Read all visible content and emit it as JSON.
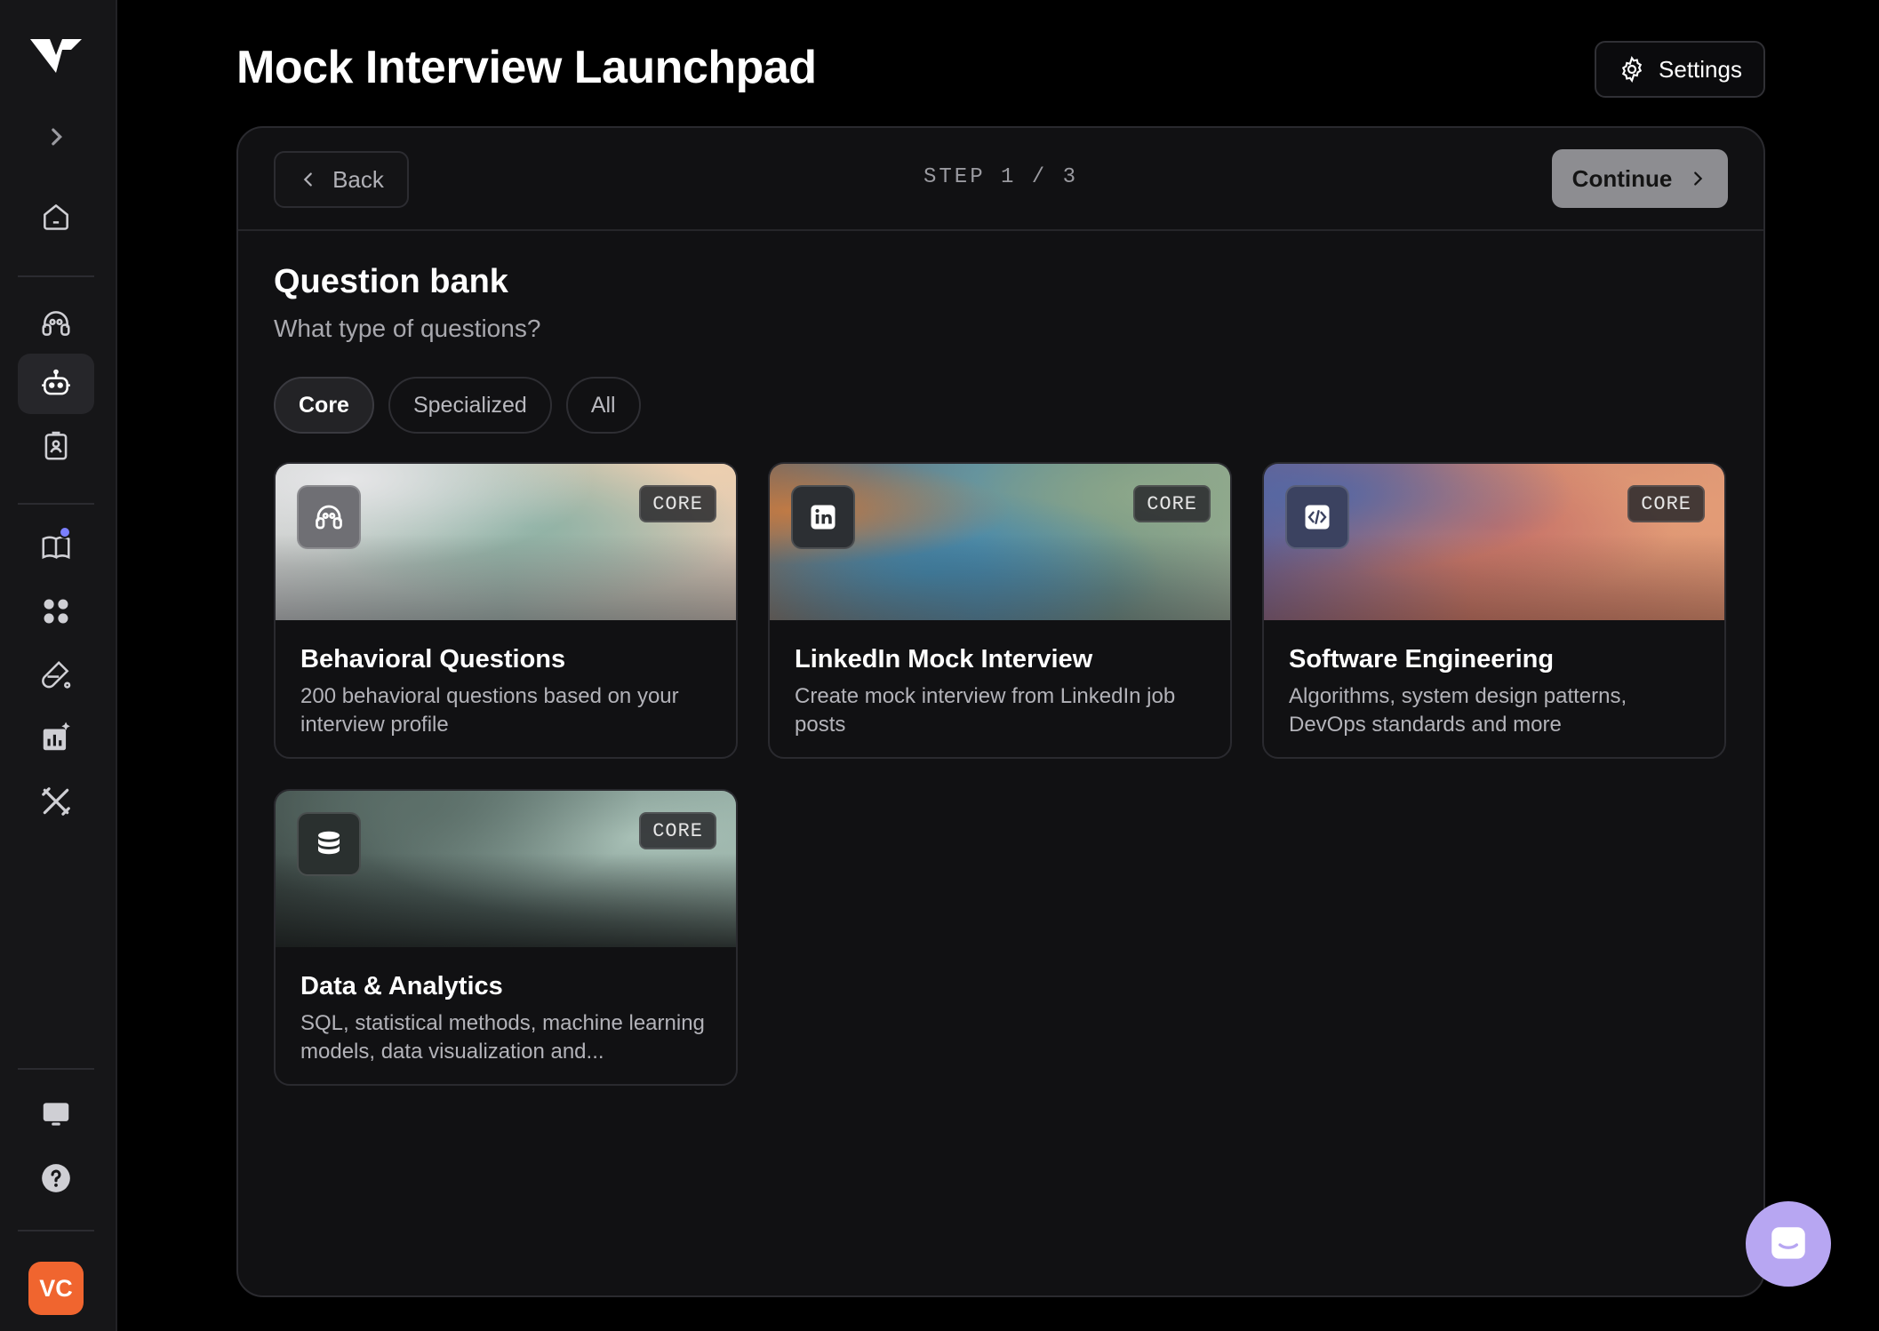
{
  "app": {
    "logo": "v-logo",
    "title": "Mock Interview Launchpad"
  },
  "header": {
    "settings_label": "Settings",
    "settings_icon": "gear-icon"
  },
  "sidebar": {
    "items": [
      {
        "name": "expand",
        "icon": "chevron-right-icon"
      },
      {
        "name": "home",
        "icon": "home-icon"
      },
      {
        "name": "interview-coach",
        "icon": "headphones-icon"
      },
      {
        "name": "mock-interview",
        "icon": "robot-icon",
        "active": true
      },
      {
        "name": "badge",
        "icon": "id-badge-icon"
      },
      {
        "name": "guides",
        "icon": "book-icon",
        "notification": true
      },
      {
        "name": "apps",
        "icon": "apps-icon"
      },
      {
        "name": "lab",
        "icon": "flask-icon"
      },
      {
        "name": "analytics",
        "icon": "chart-icon"
      },
      {
        "name": "tools",
        "icon": "tools-icon"
      },
      {
        "name": "display",
        "icon": "monitor-icon"
      },
      {
        "name": "help",
        "icon": "help-icon"
      }
    ],
    "avatar_initials": "VC"
  },
  "wizard": {
    "back_label": "Back",
    "step_label": "STEP 1 / 3",
    "continue_label": "Continue"
  },
  "section": {
    "title": "Question bank",
    "subtitle": "What type of questions?"
  },
  "filters": [
    {
      "label": "Core",
      "active": true
    },
    {
      "label": "Specialized",
      "active": false
    },
    {
      "label": "All",
      "active": false
    }
  ],
  "cards": [
    {
      "title": "Behavioral Questions",
      "desc": "200 behavioral questions based on your interview profile",
      "badge": "CORE",
      "icon": "headphones-icon"
    },
    {
      "title": "LinkedIn Mock Interview",
      "desc": "Create mock interview from LinkedIn job posts",
      "badge": "CORE",
      "icon": "linkedin-icon"
    },
    {
      "title": "Software Engineering",
      "desc": "Algorithms, system design patterns, DevOps standards and more",
      "badge": "CORE",
      "icon": "code-icon"
    },
    {
      "title": "Data & Analytics",
      "desc": "SQL, statistical methods, machine learning models, data visualization and...",
      "badge": "CORE",
      "icon": "database-icon"
    }
  ],
  "chat": {
    "icon": "chat-icon"
  },
  "colors": {
    "accent": "#7b7fff",
    "avatar": "#f0652f",
    "chat": "#b7a6f2"
  }
}
